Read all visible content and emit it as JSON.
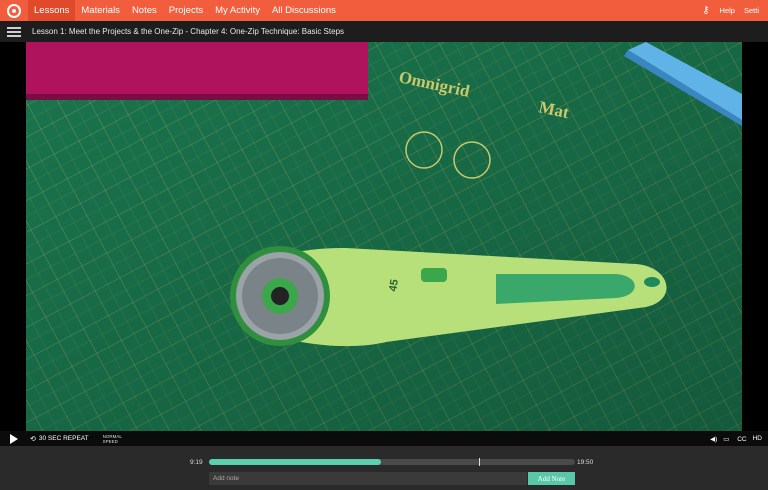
{
  "nav": {
    "items": [
      {
        "label": "Lessons",
        "active": true
      },
      {
        "label": "Materials",
        "active": false
      },
      {
        "label": "Notes",
        "active": false
      },
      {
        "label": "Projects",
        "active": false
      },
      {
        "label": "My Activity",
        "active": false
      },
      {
        "label": "All Discussions",
        "active": false
      }
    ],
    "help": "Help",
    "settings": "Setti"
  },
  "lesson": {
    "title": "Lesson 1: Meet the Projects & the One-Zip - Chapter 4: One-Zip Technique: Basic Steps"
  },
  "video": {
    "mat_brand": "Omnigrid",
    "mat_word": "Mat",
    "cutter_label": "45"
  },
  "controls": {
    "repeat_label": "30 SEC REPEAT",
    "speed_line1": "NORMAL",
    "speed_line2": "SPEED",
    "cc": "CC",
    "hd": "HD"
  },
  "player": {
    "current_time": "9:19",
    "total_time": "19:50",
    "progress": 0.47
  },
  "notes": {
    "placeholder": "Add note",
    "button": "Add Note"
  },
  "colors": {
    "nav": "#f25e3d",
    "accent": "#58c8a8",
    "mat": "#1f8a5e"
  }
}
